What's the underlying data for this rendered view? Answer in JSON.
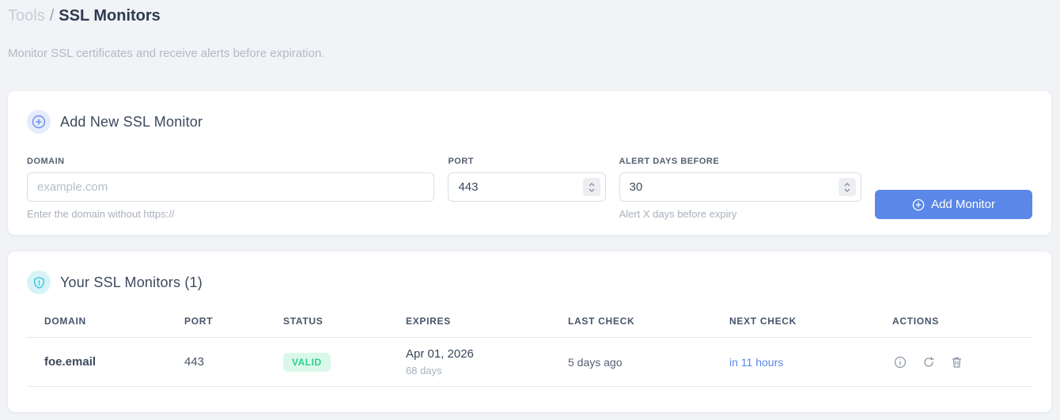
{
  "breadcrumb": {
    "section": "Tools",
    "separator": "/",
    "page": "SSL Monitors"
  },
  "subtitle": "Monitor SSL certificates and receive alerts before expiration.",
  "add_monitor_card": {
    "title": "Add New SSL Monitor",
    "fields": {
      "domain": {
        "label": "DOMAIN",
        "placeholder": "example.com",
        "helper": "Enter the domain without https://"
      },
      "port": {
        "label": "PORT",
        "value": "443"
      },
      "alert_days": {
        "label": "ALERT DAYS BEFORE",
        "value": "30",
        "helper": "Alert X days before expiry"
      }
    },
    "submit_label": "Add Monitor"
  },
  "monitors_card": {
    "title": "Your SSL Monitors (1)",
    "table": {
      "headers": [
        "DOMAIN",
        "PORT",
        "STATUS",
        "EXPIRES",
        "LAST CHECK",
        "NEXT CHECK",
        "ACTIONS"
      ],
      "rows": [
        {
          "domain": "foe.email",
          "port": "443",
          "status": "VALID",
          "expires_date": "Apr 01, 2026",
          "expires_days": "68 days",
          "last_check": "5 days ago",
          "next_check": "in 11 hours"
        }
      ]
    }
  },
  "icons": {
    "add_badge": "plus-circle-icon",
    "list_badge": "shield-icon",
    "button": "plus-circle-icon",
    "row_actions": [
      "info-icon",
      "refresh-icon",
      "trash-icon"
    ]
  },
  "colors": {
    "accent_blue": "#5b87e8",
    "valid_badge_bg": "#d9f8ea",
    "valid_badge_text": "#2bd08a",
    "plus_badge_bg": "#e4ebfc",
    "shield_badge_bg": "#d7f3f8",
    "shield_icon": "#2ac4da",
    "page_bg": "#f1f3f6"
  }
}
